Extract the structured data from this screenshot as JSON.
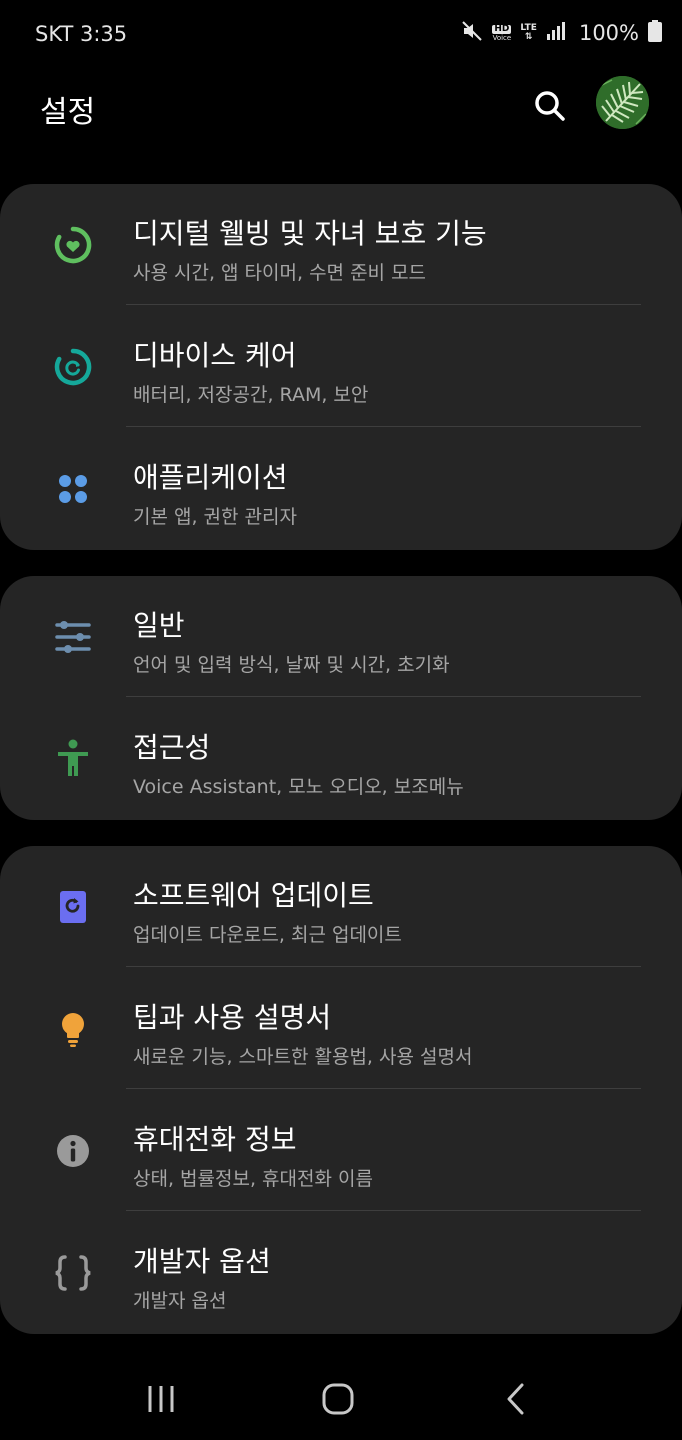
{
  "status": {
    "carrier_time": "SKT 3:35",
    "hd_label": "HD",
    "voice_label": "Voice",
    "lte_label": "LTE",
    "battery_pct": "100%",
    "icons": [
      "mute-icon",
      "hd-voice-icon",
      "lte-icon",
      "signal-icon",
      "battery-icon"
    ]
  },
  "header": {
    "title": "설정",
    "icons": [
      "search-icon",
      "avatar"
    ]
  },
  "groups": [
    {
      "items": [
        {
          "title": "디지털 웰빙 및 자녀 보호 기능",
          "subtitle": "사용 시간, 앱 타이머, 수면 준비 모드",
          "icon": "digital-wellbeing-icon",
          "color": "#5fbf5f"
        },
        {
          "title": "디바이스 케어",
          "subtitle": "배터리, 저장공간, RAM, 보안",
          "icon": "device-care-icon",
          "color": "#15a89a"
        },
        {
          "title": "애플리케이션",
          "subtitle": "기본 앱, 권한 관리자",
          "icon": "apps-icon",
          "color": "#5b9ce6"
        }
      ]
    },
    {
      "items": [
        {
          "title": "일반",
          "subtitle": "언어 및 입력 방식, 날짜 및 시간, 초기화",
          "icon": "general-sliders-icon",
          "color": "#6d8eae"
        },
        {
          "title": "접근성",
          "subtitle": "Voice Assistant, 모노 오디오, 보조메뉴",
          "icon": "accessibility-icon",
          "color": "#3f9a52"
        }
      ]
    },
    {
      "items": [
        {
          "title": "소프트웨어 업데이트",
          "subtitle": "업데이트 다운로드, 최근 업데이트",
          "icon": "software-update-icon",
          "color": "#6b6ef0"
        },
        {
          "title": "팁과 사용 설명서",
          "subtitle": "새로운 기능, 스마트한 활용법, 사용 설명서",
          "icon": "lightbulb-icon",
          "color": "#f0a33a"
        },
        {
          "title": "휴대전화 정보",
          "subtitle": "상태, 법률정보, 휴대전화 이름",
          "icon": "info-icon",
          "color": "#9a9a9a"
        },
        {
          "title": "개발자 옵션",
          "subtitle": "개발자 옵션",
          "icon": "developer-braces-icon",
          "color": "#9a9a9a"
        }
      ]
    }
  ],
  "nav": {
    "icons": [
      "recents-icon",
      "home-icon",
      "back-icon"
    ]
  }
}
